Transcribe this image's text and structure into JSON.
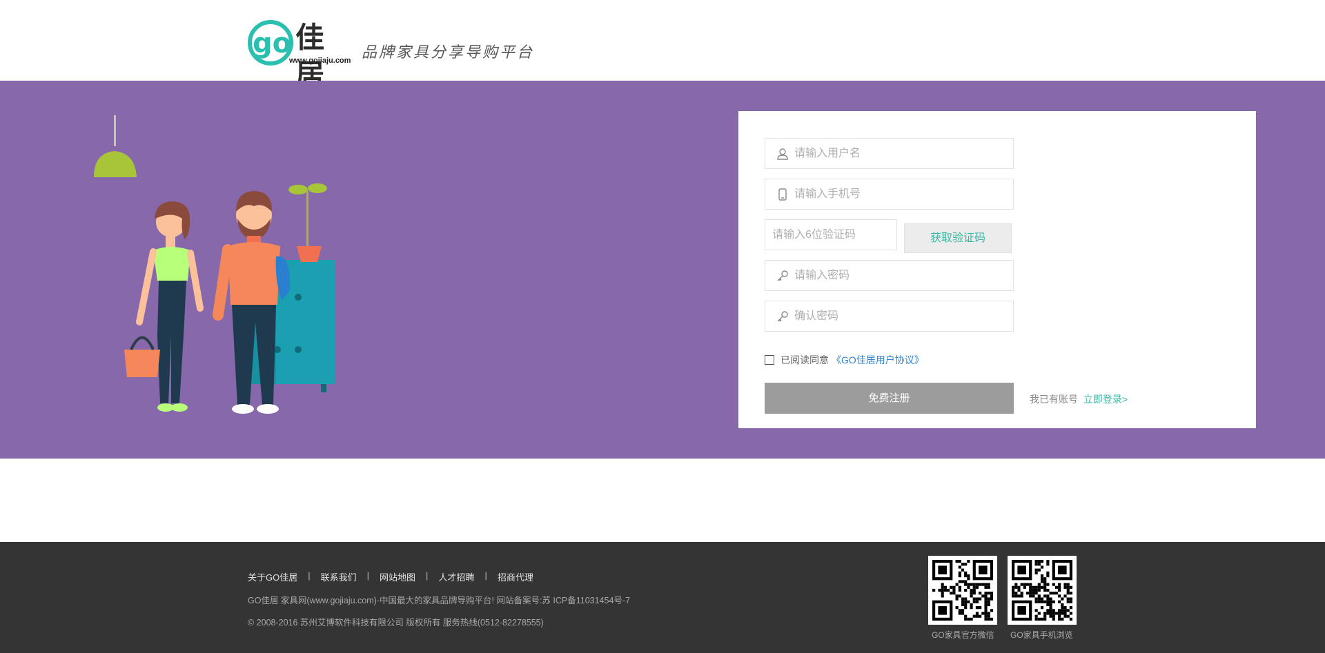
{
  "header": {
    "logo_go": "go",
    "logo_name": "佳居",
    "logo_url": "www.gojiaju.com",
    "slogan": "品牌家具分享导购平台"
  },
  "form": {
    "username_placeholder": "请输入用户名",
    "phone_placeholder": "请输入手机号",
    "code_placeholder": "请输入6位验证码",
    "get_code_label": "获取验证码",
    "password_placeholder": "请输入密码",
    "confirm_placeholder": "确认密码",
    "agree_text": "已阅读同意",
    "agreement_link": "《GO佳居用户协议》",
    "submit_label": "免费注册",
    "has_account_text": "我已有账号",
    "login_link": "立即登录>"
  },
  "footer": {
    "links": [
      "关于GO佳居",
      "联系我们",
      "网站地图",
      "人才招聘",
      "招商代理"
    ],
    "separator": "|",
    "line1": "GO佳居 家具网(www.gojiaju.com)-中国最大的家具品牌导购平台! 网站备案号:苏 ICP备11031454号-7",
    "line2": "© 2008-2016 苏州艾博软件科技有限公司 版权所有 服务热线(0512-82278555)",
    "qr1_caption": "GO家具官方微信",
    "qr2_caption": "GO家具手机浏览"
  },
  "colors": {
    "banner": "#8768ab",
    "accent": "#3bb7a5",
    "link": "#2a86d6",
    "footer": "#343434"
  }
}
